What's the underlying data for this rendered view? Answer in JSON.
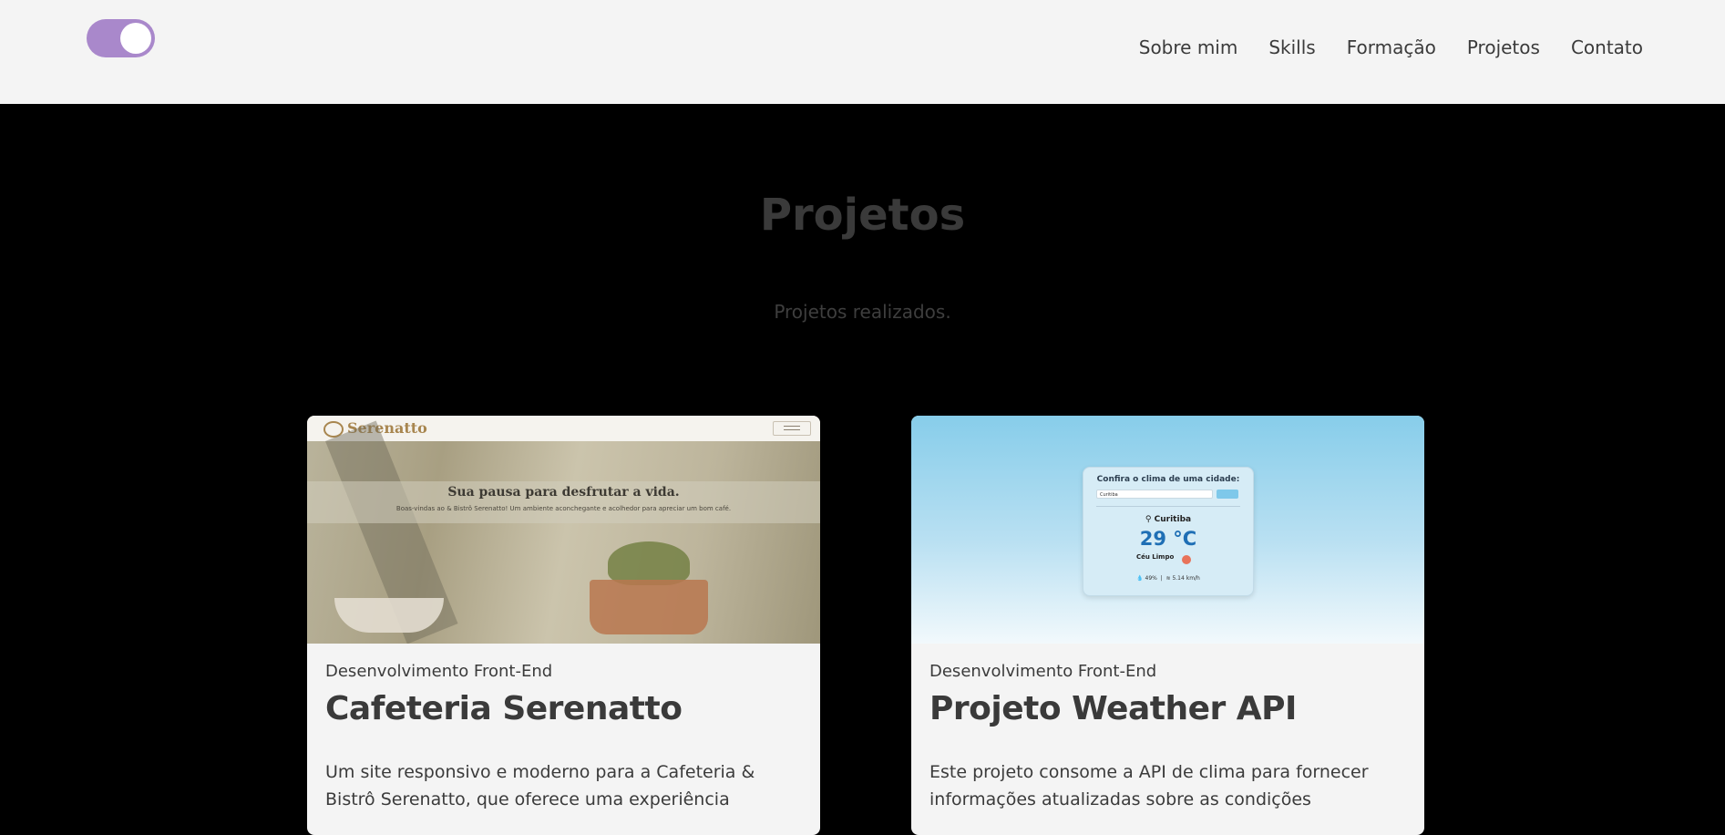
{
  "header": {
    "theme_toggle": {
      "state": "on",
      "track_color": "#a988cb"
    },
    "nav": [
      "Sobre mim",
      "Skills",
      "Formação",
      "Projetos",
      "Contato"
    ]
  },
  "projects_section": {
    "title": "Projetos",
    "subtitle": "Projetos realizados."
  },
  "projects": [
    {
      "category": "Desenvolvimento Front-End",
      "title": "Cafeteria Serenatto",
      "description": "Um site responsivo e moderno para a Cafeteria & Bistrô Serenatto, que oferece uma experiência",
      "preview": {
        "logo": "Serenatto",
        "headline": "Sua pausa para desfrutar a vida.",
        "text": "Boas-vindas ao & Bistrô Serenatto! Um ambiente aconchegante e acolhedor para apreciar um bom café."
      }
    },
    {
      "category": "Desenvolvimento Front-End",
      "title": "Projeto Weather API",
      "description": "Este projeto consome a API de clima para fornecer informações atualizadas sobre as condições",
      "preview": {
        "question": "Confira o clima de uma cidade:",
        "input_value": "Curitiba",
        "city": "Curitiba",
        "temperature": "29 °C",
        "condition": "Céu Limpo",
        "humidity": "49%",
        "wind": "5.14 km/h"
      }
    }
  ]
}
